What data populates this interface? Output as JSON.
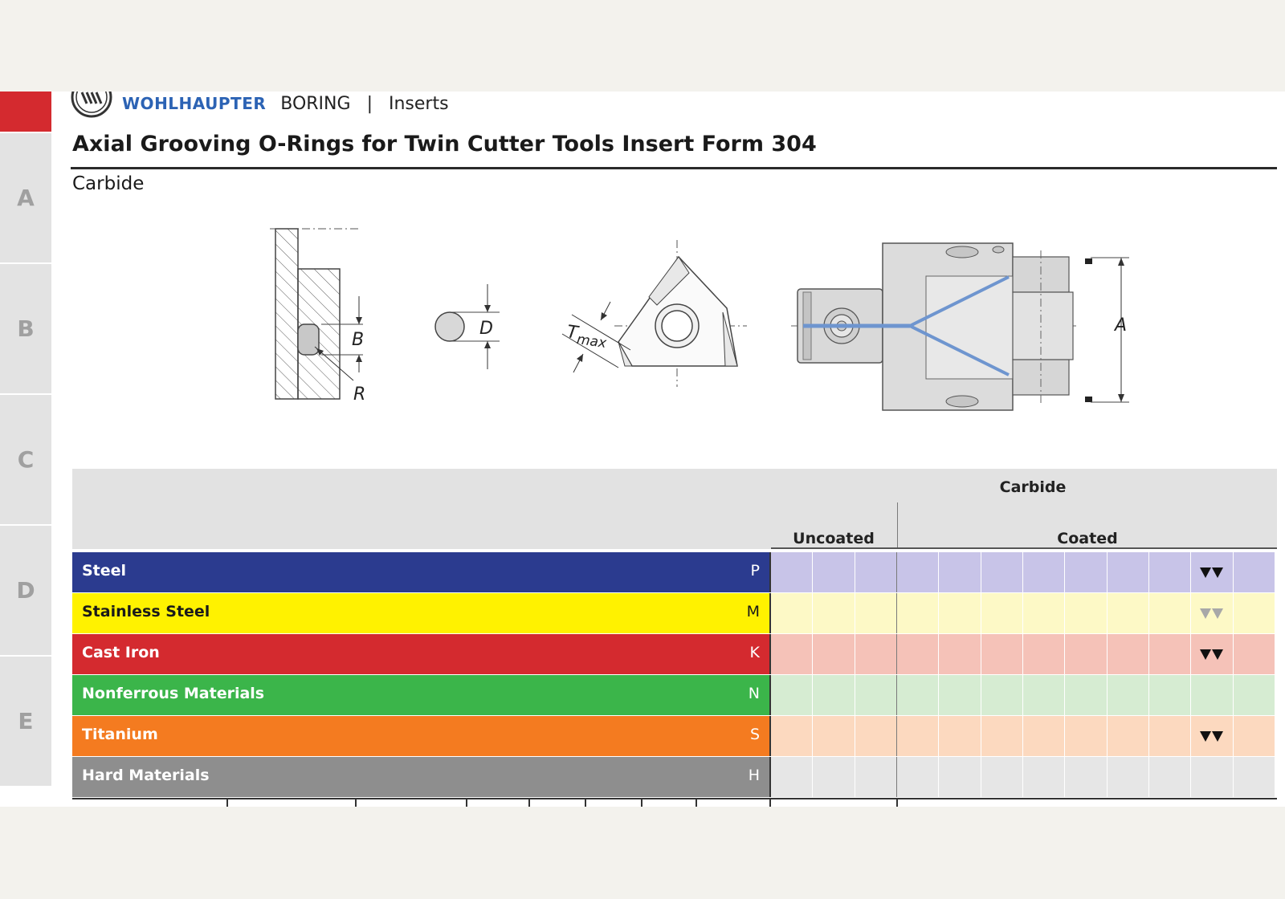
{
  "header": {
    "brand": "WOHLHAUPTER",
    "section": "BORING",
    "separator": "|",
    "page": "Inserts"
  },
  "title": "Axial Grooving O-Rings for Twin Cutter Tools Insert Form 304",
  "subtitle": "Carbide",
  "side_tabs": [
    "A",
    "B",
    "C",
    "D",
    "E"
  ],
  "drawing_labels": {
    "b": "B",
    "r": "R",
    "d": "D",
    "tmax_t": "T",
    "tmax_sub": "max",
    "a": "A"
  },
  "table": {
    "group_header": "Carbide",
    "col_uncoated": "Uncoated",
    "col_coated": "Coated",
    "rows": [
      {
        "name": "Steel",
        "code": "P",
        "color": "#2b3b8f",
        "cell_color": "#c8c4e8",
        "symbol_col": 10,
        "symbol": "filled"
      },
      {
        "name": "Stainless Steel",
        "code": "M",
        "color": "#fff200",
        "cell_color": "#fdf9c6",
        "symbol_col": 10,
        "symbol": "hollow"
      },
      {
        "name": "Cast Iron",
        "code": "K",
        "color": "#d42a2f",
        "cell_color": "#f5c2b8",
        "symbol_col": 10,
        "symbol": "filled"
      },
      {
        "name": "Nonferrous Materials",
        "code": "N",
        "color": "#3bb54a",
        "cell_color": "#d6ecd2",
        "symbol_col": -1,
        "symbol": "none"
      },
      {
        "name": "Titanium",
        "code": "S",
        "color": "#f47b20",
        "cell_color": "#fcd9bf",
        "symbol_col": 10,
        "symbol": "filled"
      },
      {
        "name": "Hard Materials",
        "code": "H",
        "color": "#8e8e8e",
        "cell_color": "#e6e6e6",
        "symbol_col": -1,
        "symbol": "none"
      }
    ]
  }
}
